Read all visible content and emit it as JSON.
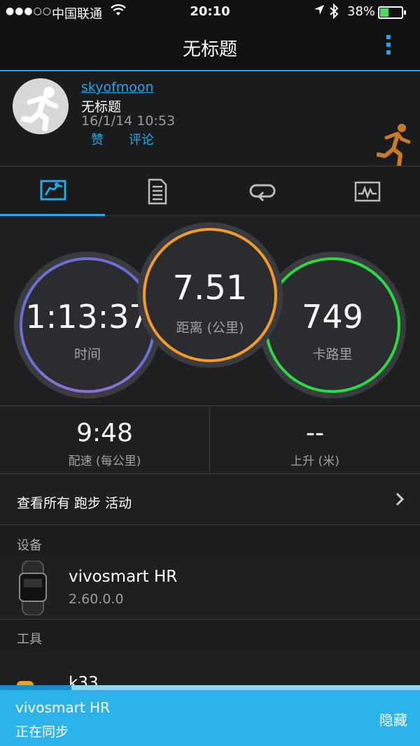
{
  "status_bar": {
    "signal": "●●●○○",
    "carrier": "中国联通",
    "time": "20:10",
    "battery": "38%"
  },
  "navbar": {
    "title": "无标题"
  },
  "activity": {
    "username": "skyofmoon",
    "title": "无标题",
    "datetime": "16/1/14 10:53",
    "like_label": "赞",
    "comment_label": "评论"
  },
  "tabs": [
    {
      "icon": "run-chart-icon",
      "active": true
    },
    {
      "icon": "document-list-icon",
      "active": false
    },
    {
      "icon": "laps-loop-icon",
      "active": false
    },
    {
      "icon": "graph-icon",
      "active": false
    }
  ],
  "stats": {
    "time": {
      "value": "1:13:37",
      "label": "时间",
      "color": "#6b6fd6"
    },
    "distance": {
      "value": "7.51",
      "label": "距离 (公里)",
      "color": "#f39a2b"
    },
    "calories": {
      "value": "749",
      "label": "卡路里",
      "color": "#2ad944"
    }
  },
  "pace": {
    "value": "9:48",
    "label": "配速 (每公里)"
  },
  "elevation": {
    "value": "--",
    "label": "上升 (米)"
  },
  "view_all": {
    "label": "查看所有 跑步 活动"
  },
  "devices": {
    "header": "设备",
    "name": "vivosmart HR",
    "version": "2.60.0.0"
  },
  "tools": {
    "header": "工具",
    "item": "k33"
  },
  "sync": {
    "device": "vivosmart HR",
    "status": "正在同步",
    "hide_label": "隐藏",
    "progress": 0.17
  }
}
